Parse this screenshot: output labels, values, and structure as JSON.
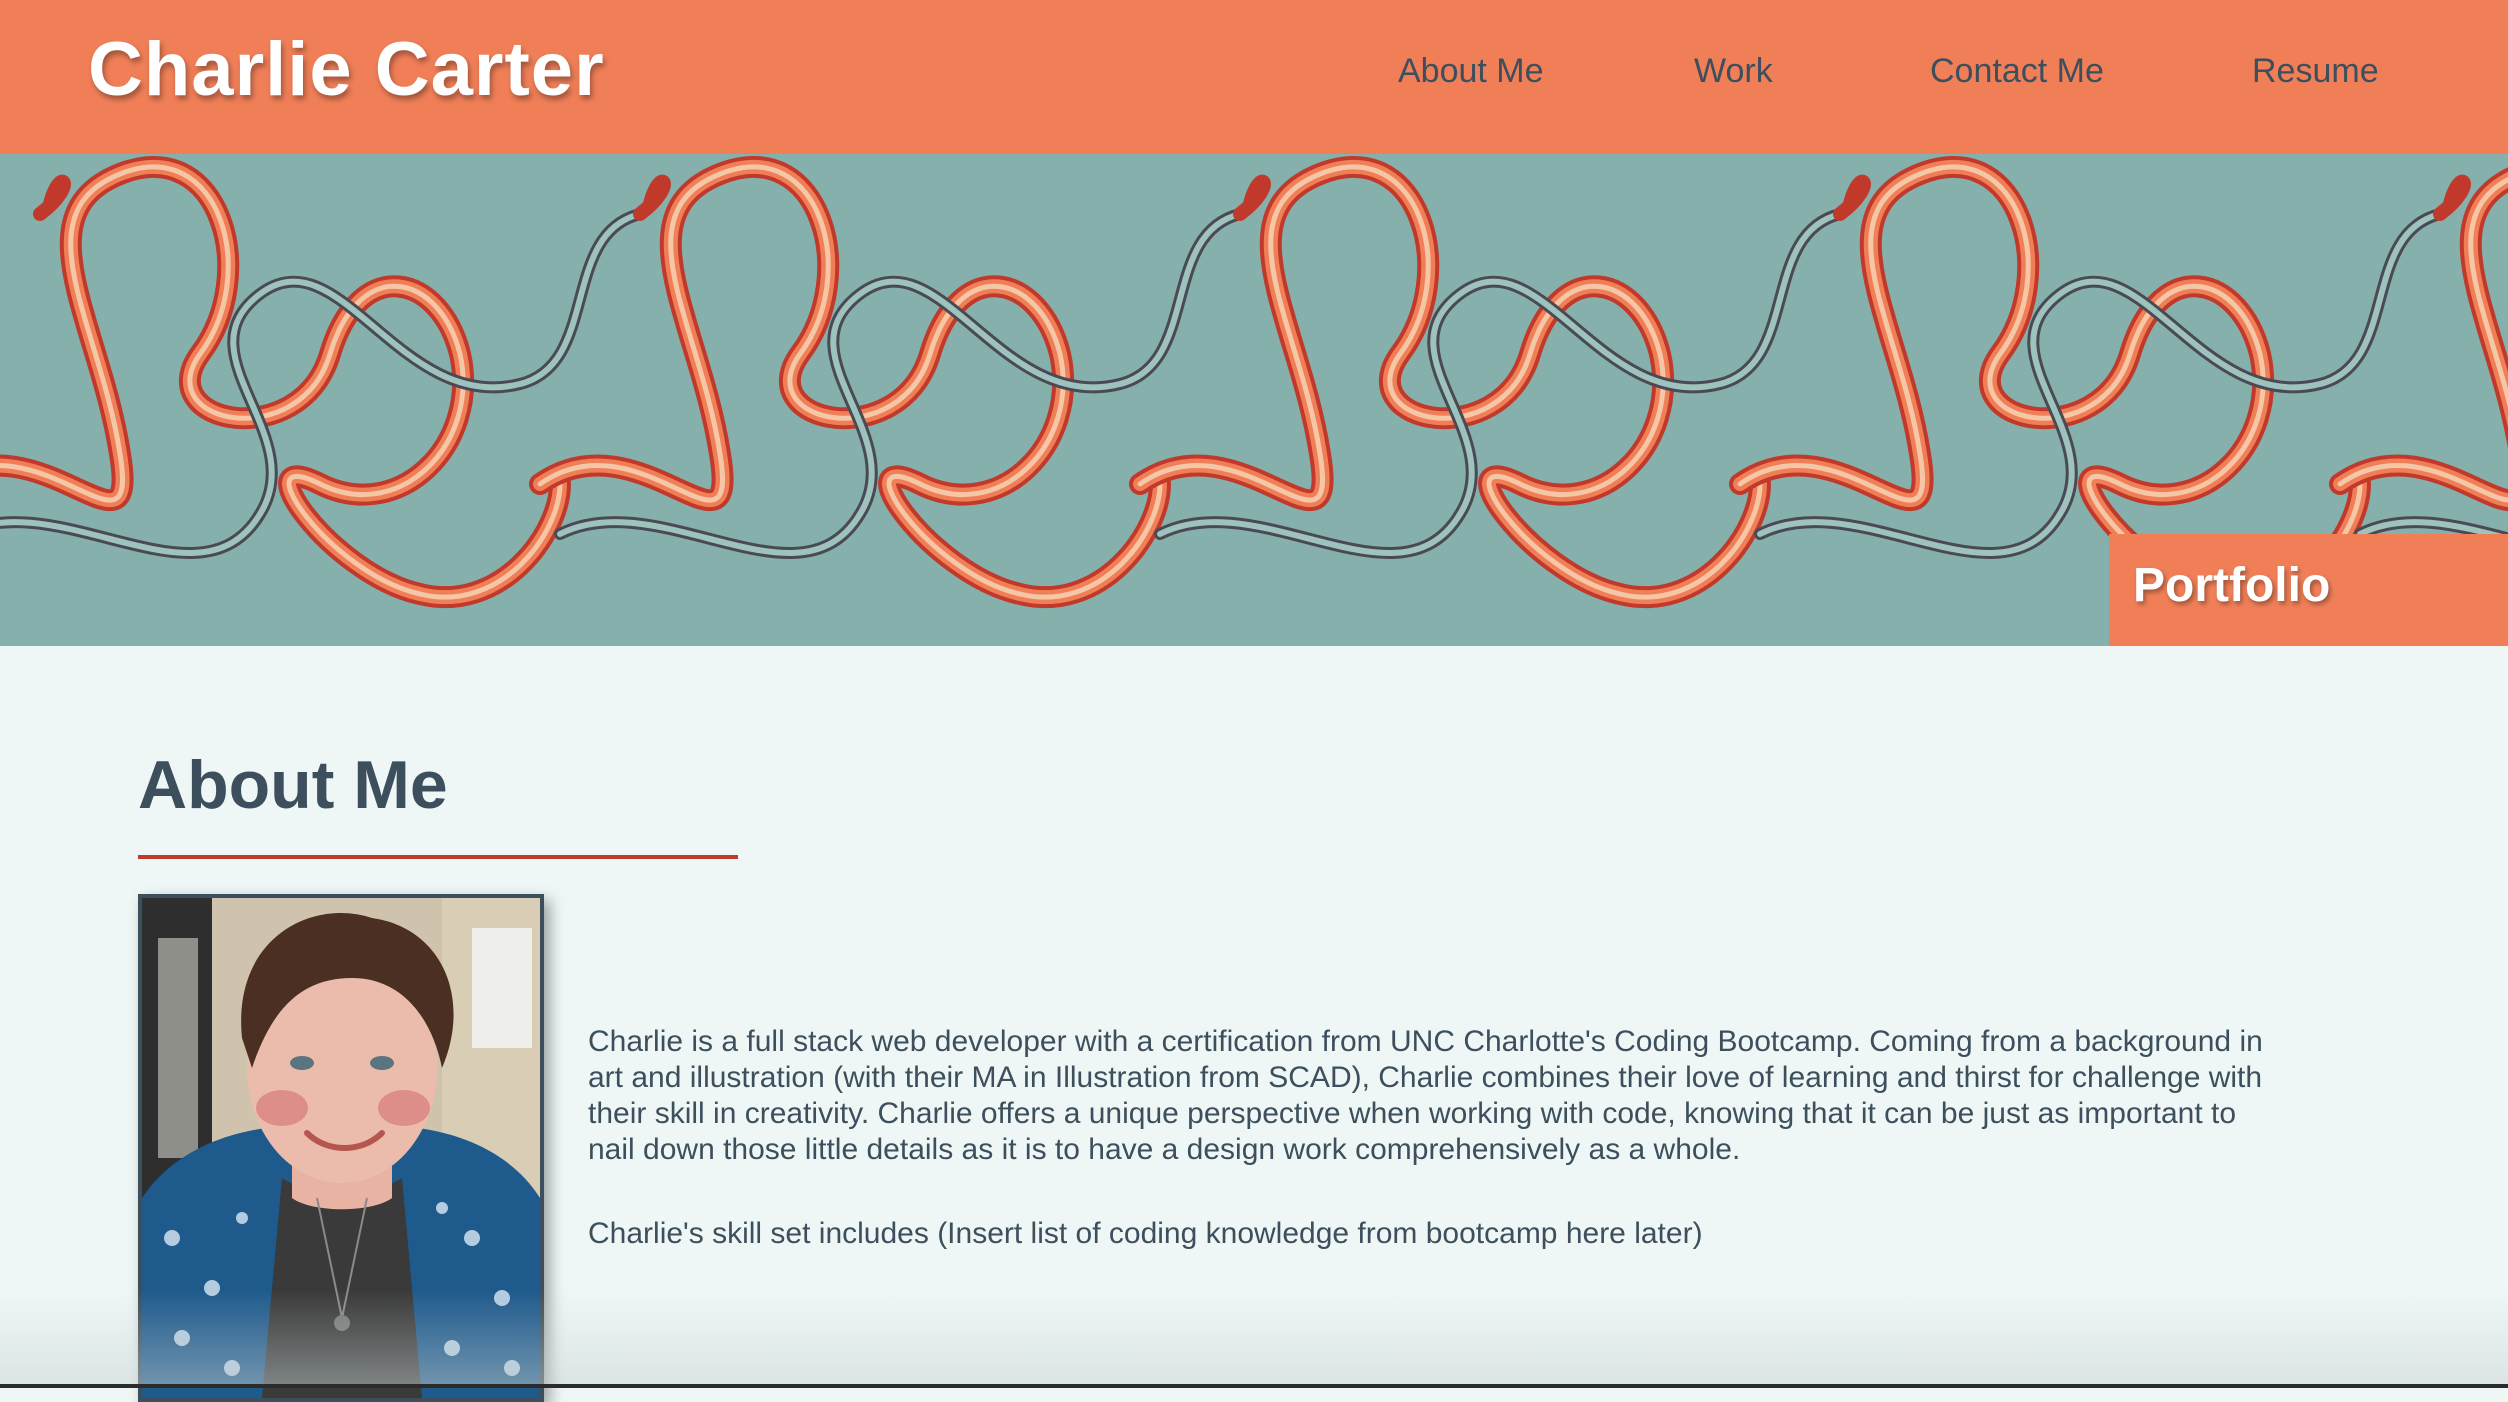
{
  "header": {
    "site_name": "Charlie Carter",
    "nav": [
      {
        "label": "About Me"
      },
      {
        "label": "Work"
      },
      {
        "label": "Contact Me"
      },
      {
        "label": "Resume"
      }
    ]
  },
  "hero": {
    "tag": "Portfolio",
    "pattern": "ribbon-pattern-illustration"
  },
  "about": {
    "title": "About Me",
    "photo": "profile-photo",
    "bio": "Charlie is a full stack web developer with a certification from UNC Charlotte's Coding Bootcamp. Coming from a background in art and illustration (with their MA in Illustration from SCAD), Charlie combines their love of learning and thirst for challenge with their skill in creativity. Charlie offers a unique perspective when working with code, knowing that it can be just as important to nail down those little details as it is to have a design work comprehensively as a whole.",
    "skills": "Charlie's skill set includes (Insert list of coding knowledge from bootcamp here later)"
  },
  "colors": {
    "accent": "#f07f58",
    "hero_bg": "#85b0ab",
    "page_bg": "#eef7f6",
    "text": "#3d4f5c",
    "rule": "#c0392b"
  }
}
